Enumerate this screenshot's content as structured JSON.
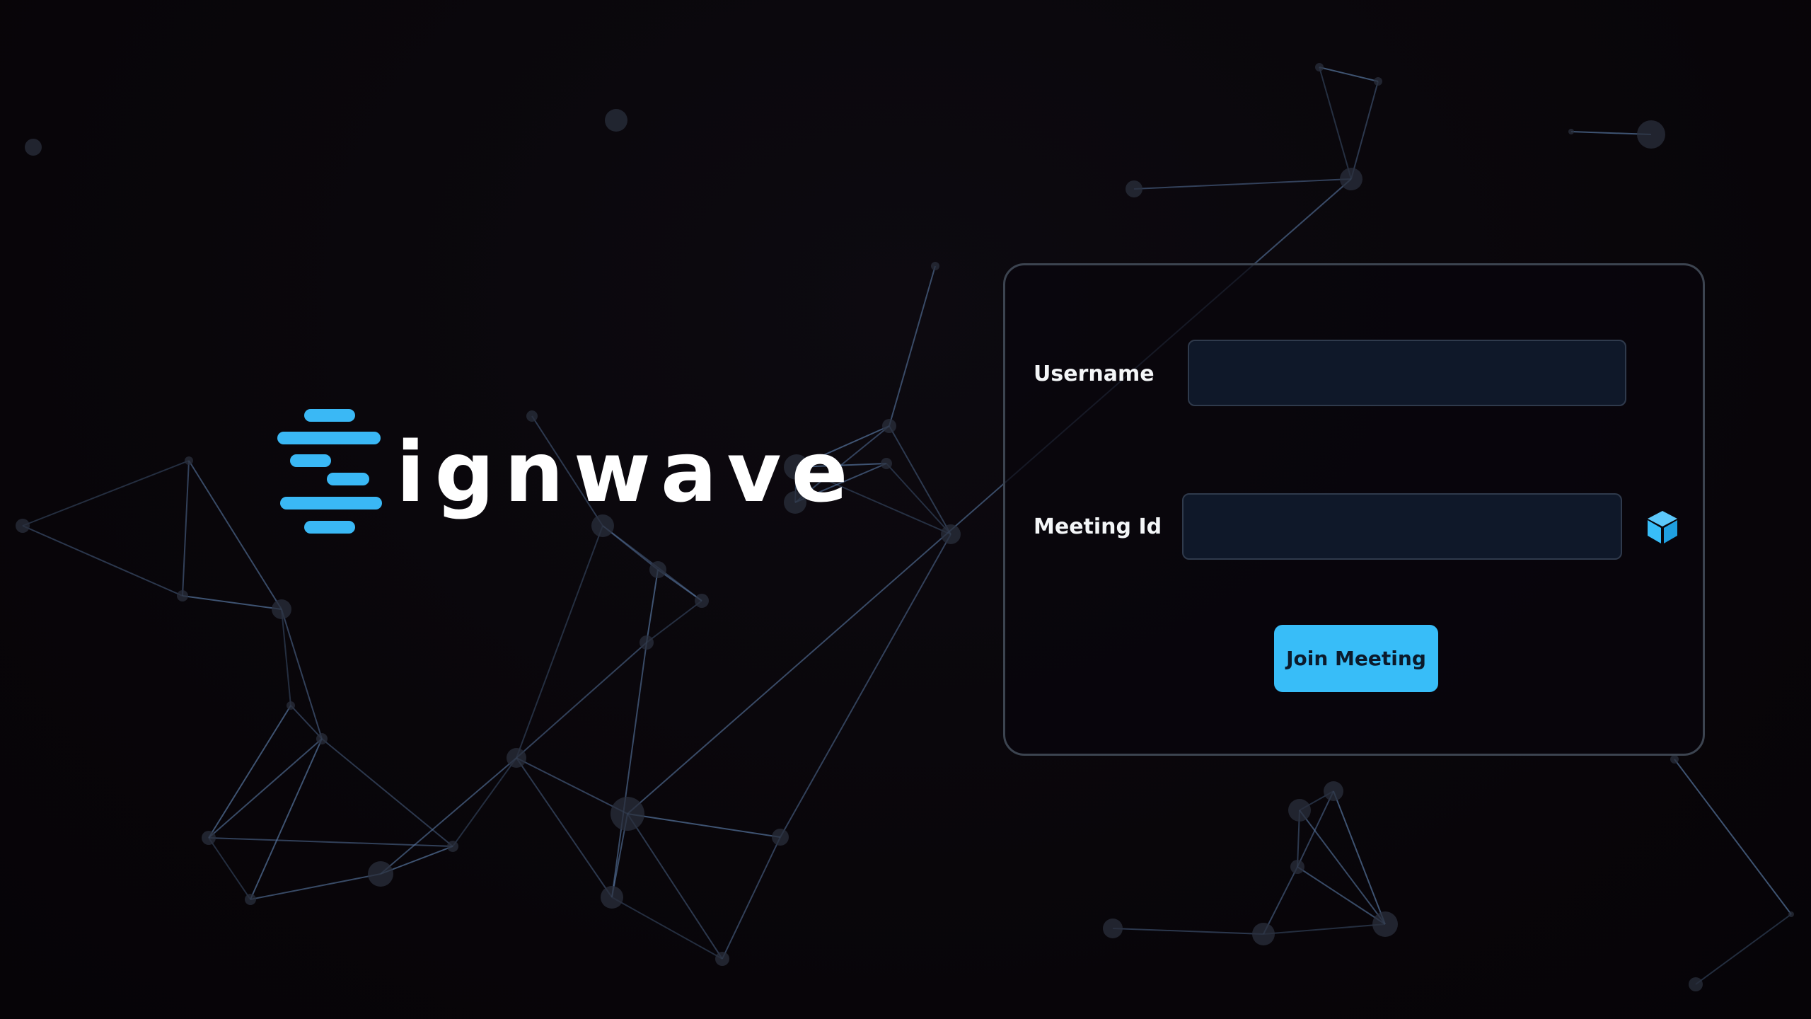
{
  "logo": {
    "text": "ignwave",
    "accent_color": "#3ab8f5"
  },
  "form": {
    "username_label": "Username",
    "username_value": "",
    "meeting_label": "Meeting Id",
    "meeting_value": "",
    "generate_icon": "cube-icon",
    "join_label": "Join Meeting",
    "join_color": "#38bdf8"
  },
  "theme": {
    "background": "#0a060b",
    "card_border": "#3c4450",
    "input_background": "#0f1829",
    "network_line": "#5a7aa6"
  }
}
